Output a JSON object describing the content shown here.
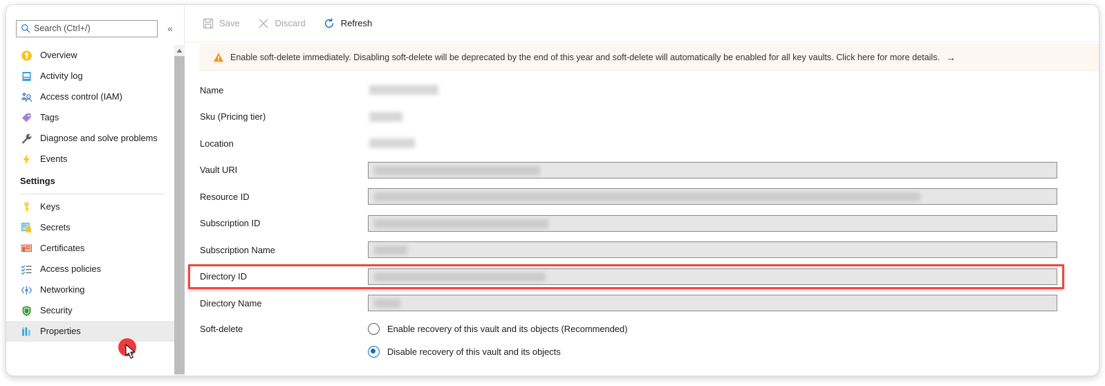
{
  "sidebar": {
    "search": {
      "placeholder": "Search (Ctrl+/)",
      "value": "",
      "icon": "search-icon"
    },
    "collapse_icon": "«",
    "items": [
      {
        "label": "Overview",
        "icon": "key-circle-icon",
        "selected": false
      },
      {
        "label": "Activity log",
        "icon": "activity-log-icon",
        "selected": false
      },
      {
        "label": "Access control (IAM)",
        "icon": "access-control-icon",
        "selected": false
      },
      {
        "label": "Tags",
        "icon": "tag-icon",
        "selected": false
      },
      {
        "label": "Diagnose and solve problems",
        "icon": "wrench-icon",
        "selected": false
      },
      {
        "label": "Events",
        "icon": "lightning-bolt-icon",
        "selected": false
      }
    ],
    "section_label": "Settings",
    "settings_items": [
      {
        "label": "Keys",
        "icon": "key-icon",
        "selected": false
      },
      {
        "label": "Secrets",
        "icon": "secret-lock-icon",
        "selected": false
      },
      {
        "label": "Certificates",
        "icon": "certificate-icon",
        "selected": false
      },
      {
        "label": "Access policies",
        "icon": "access-policies-icon",
        "selected": false
      },
      {
        "label": "Networking",
        "icon": "networking-icon",
        "selected": false
      },
      {
        "label": "Security",
        "icon": "shield-icon",
        "selected": false
      },
      {
        "label": "Properties",
        "icon": "properties-icon",
        "selected": true
      }
    ],
    "scrollbar": {
      "up_arrow_icon": "chevron-up-icon"
    }
  },
  "toolbar": {
    "buttons": [
      {
        "label": "Save",
        "icon": "save-disk-icon",
        "enabled": false
      },
      {
        "label": "Discard",
        "icon": "close-x-icon",
        "enabled": false
      },
      {
        "label": "Refresh",
        "icon": "refresh-icon",
        "enabled": true
      }
    ]
  },
  "banner": {
    "icon": "warning-triangle-icon",
    "text": "Enable soft-delete immediately. Disabling soft-delete will be deprecated by the end of this year and soft-delete will automatically be enabled for all key vaults. Click here for more details.",
    "arrow": "→",
    "background_color": "#fdf6f1",
    "icon_color": "#f2921d"
  },
  "form": {
    "rows": [
      {
        "label": "Name",
        "type": "text",
        "value": "",
        "redacted": true,
        "redacted_width": 100
      },
      {
        "label": "Sku (Pricing tier)",
        "type": "text",
        "value": "",
        "redacted": true,
        "redacted_width": 48
      },
      {
        "label": "Location",
        "type": "text",
        "value": "",
        "redacted": true,
        "redacted_width": 66
      },
      {
        "label": "Vault URI",
        "type": "input",
        "value": "",
        "redacted": true,
        "redacted_width": 240
      },
      {
        "label": "Resource ID",
        "type": "input",
        "value": "",
        "redacted": true,
        "redacted_width": 790
      },
      {
        "label": "Subscription ID",
        "type": "input",
        "value": "",
        "redacted": true,
        "redacted_width": 252
      },
      {
        "label": "Subscription Name",
        "type": "input",
        "value": "",
        "redacted": true,
        "redacted_width": 48
      },
      {
        "label": "Directory ID",
        "type": "input",
        "value": "",
        "redacted": true,
        "redacted_width": 248,
        "highlighted": true
      },
      {
        "label": "Directory Name",
        "type": "input",
        "value": "",
        "redacted": true,
        "redacted_width": 38
      }
    ],
    "soft_delete": {
      "label": "Soft-delete",
      "options": [
        {
          "label": "Enable recovery of this vault and its objects (Recommended)",
          "checked": false
        },
        {
          "label": "Disable recovery of this vault and its objects",
          "checked": true
        }
      ]
    }
  },
  "annotation": {
    "highlight_color": "#f4453f",
    "cursor_dot_color": "#f03a3a",
    "cursor_icon": "mouse-pointer-icon"
  }
}
